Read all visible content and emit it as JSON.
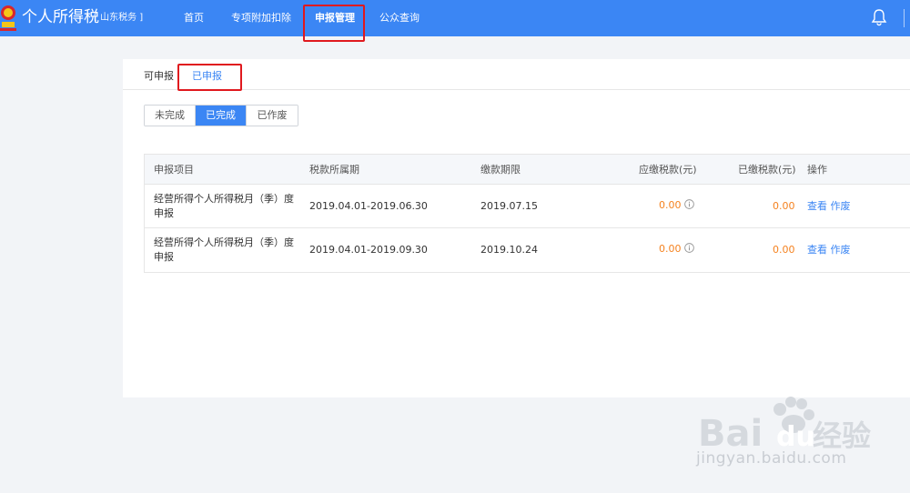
{
  "header": {
    "app_title": "个人所得税",
    "region": "[ 山东税务 ]",
    "nav": [
      {
        "label": "首页"
      },
      {
        "label": "专项附加扣除"
      },
      {
        "label": "申报管理"
      },
      {
        "label": "公众查询"
      }
    ],
    "active_nav": "申报管理",
    "icons": [
      "emblem-icon",
      "bell-icon"
    ]
  },
  "tabs": [
    {
      "label": "可申报"
    },
    {
      "label": "已申报"
    }
  ],
  "active_tab": "已申报",
  "status_filter": [
    {
      "label": "未完成"
    },
    {
      "label": "已完成"
    },
    {
      "label": "已作废"
    }
  ],
  "active_status": "已完成",
  "table": {
    "headers": [
      "申报项目",
      "税款所属期",
      "缴款期限",
      "应缴税款(元)",
      "已缴税款(元)",
      "操作"
    ],
    "rows": [
      {
        "item": "经营所得个人所得税月（季）度申报",
        "period": "2019.04.01-2019.06.30",
        "deadline": "2019.07.15",
        "tax_due": "0.00",
        "tax_paid": "0.00",
        "view": "查看",
        "void": "作废"
      },
      {
        "item": "经营所得个人所得税月（季）度申报",
        "period": "2019.04.01-2019.09.30",
        "deadline": "2019.10.24",
        "tax_due": "0.00",
        "tax_paid": "0.00",
        "view": "查看",
        "void": "作废"
      }
    ]
  },
  "watermark": {
    "text": "jingyan.baidu.com",
    "logo": "Bai du 经验"
  },
  "colors": {
    "primary": "#3b86f4",
    "highlight": "#e0191e",
    "amount": "#f5821f"
  }
}
